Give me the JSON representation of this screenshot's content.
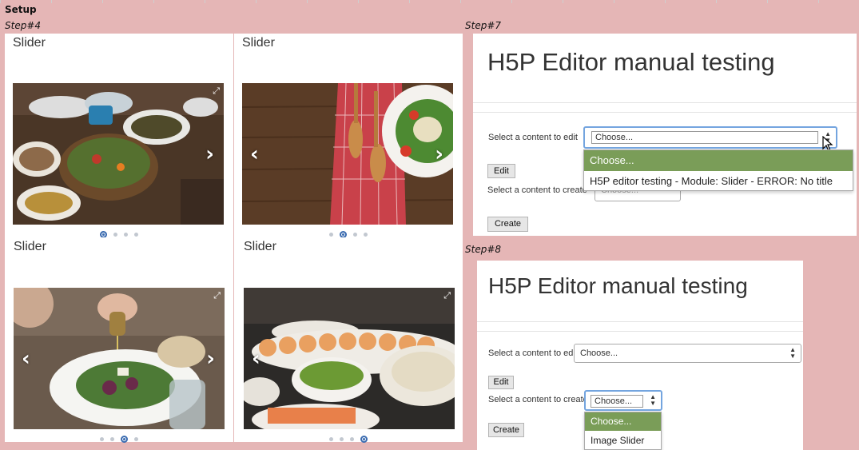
{
  "labels": {
    "setup": "Setup",
    "step4": "Step#4",
    "step7": "Step#7",
    "step8": "Step#8"
  },
  "sliders": [
    {
      "title": "Slider",
      "dots": 4,
      "active_dot": 1
    },
    {
      "title": "Slider",
      "dots": 4,
      "active_dot": 2
    },
    {
      "title": "Slider",
      "dots": 4,
      "active_dot": 3
    },
    {
      "title": "Slider",
      "dots": 4,
      "active_dot": 4
    }
  ],
  "step7": {
    "title": "H5P Editor manual testing",
    "edit_label": "Select a content to edit",
    "edit_select_value": "Choose...",
    "edit_button": "Edit",
    "create_label": "Select a content to create",
    "create_select_value": "Choose...",
    "create_button": "Create",
    "dropdown_options": [
      "Choose...",
      "H5P editor testing - Module: Slider - ERROR: No title"
    ]
  },
  "step8": {
    "title": "H5P Editor manual testing",
    "edit_label": "Select a content to edit",
    "edit_select_value": "Choose...",
    "edit_button": "Edit",
    "create_label": "Select a content to create",
    "create_select_value": "Choose...",
    "create_button": "Create",
    "dropdown_options": [
      "Choose...",
      "Image Slider"
    ]
  },
  "colors": {
    "background": "#e5b6b6",
    "dropdown_selected": "#7a9d58",
    "active_dot": "#3a6bb0",
    "focus_ring": "#74a5df"
  }
}
